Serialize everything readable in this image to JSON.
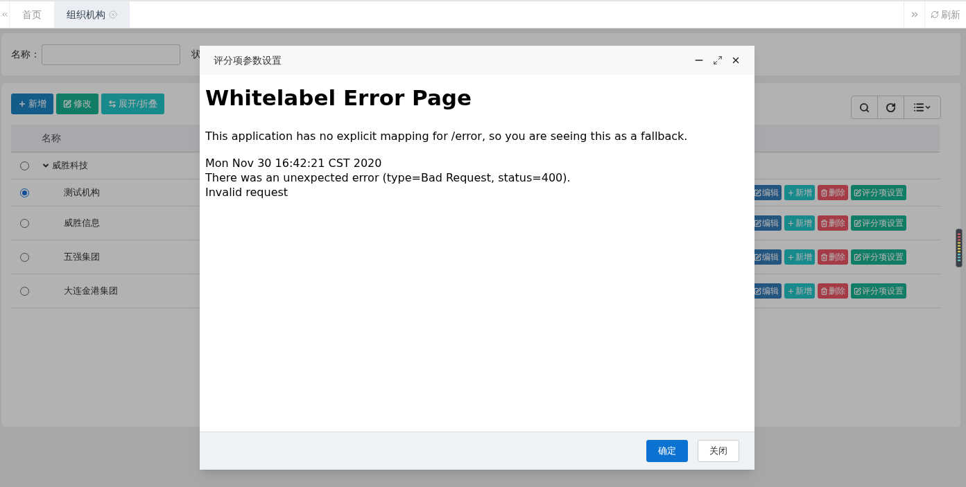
{
  "tabs": [
    {
      "label": "首页",
      "selected": false,
      "closable": false
    },
    {
      "label": "组织机构",
      "selected": true,
      "closable": true
    }
  ],
  "refresh_button": "刷新",
  "search_form": {
    "name_label": "名称：",
    "status_label": "状"
  },
  "toolbar": [
    {
      "label": "新增",
      "kind": "add"
    },
    {
      "label": "修改",
      "kind": "edit"
    },
    {
      "label": "展开/折叠",
      "kind": "toggle"
    }
  ],
  "table": {
    "columns": [
      "名称"
    ],
    "rows": [
      {
        "name": "威胜科技",
        "selected": false,
        "expanded": true,
        "children": [
          {
            "name": "测试机构",
            "selected": true,
            "actions": [
              {
                "label": "编辑",
                "kind": "edit"
              },
              {
                "label": "新增",
                "kind": "add"
              },
              {
                "label": "删除",
                "kind": "delete"
              },
              {
                "label": "评分项设置",
                "kind": "settings"
              }
            ]
          },
          {
            "name": "威胜信息",
            "selected": false,
            "actions": [
              {
                "label": "编辑",
                "kind": "edit"
              },
              {
                "label": "新增",
                "kind": "add"
              },
              {
                "label": "删除",
                "kind": "delete"
              },
              {
                "label": "评分项设置",
                "kind": "settings"
              }
            ]
          },
          {
            "name": "五强集团",
            "selected": false,
            "actions": [
              {
                "label": "编辑",
                "kind": "edit"
              },
              {
                "label": "新增",
                "kind": "add"
              },
              {
                "label": "删除",
                "kind": "delete"
              },
              {
                "label": "评分项设置",
                "kind": "settings"
              }
            ]
          },
          {
            "name": "大连金港集团",
            "selected": false,
            "actions": [
              {
                "label": "编辑",
                "kind": "edit"
              },
              {
                "label": "新增",
                "kind": "add"
              },
              {
                "label": "删除",
                "kind": "delete"
              },
              {
                "label": "评分项设置",
                "kind": "settings"
              }
            ]
          }
        ]
      }
    ]
  },
  "dialog": {
    "title": "评分项参数设置",
    "heading": "Whitelabel Error Page",
    "message": "This application has no explicit mapping for /error, so you are seeing this as a fallback.",
    "details": [
      "Mon Nov 30 16:42:21 CST 2020",
      "There was an unexpected error (type=Bad Request, status=400).",
      "Invalid request"
    ],
    "buttons": [
      {
        "label": "确定",
        "kind": "primary"
      },
      {
        "label": "关闭",
        "kind": "default"
      }
    ]
  }
}
